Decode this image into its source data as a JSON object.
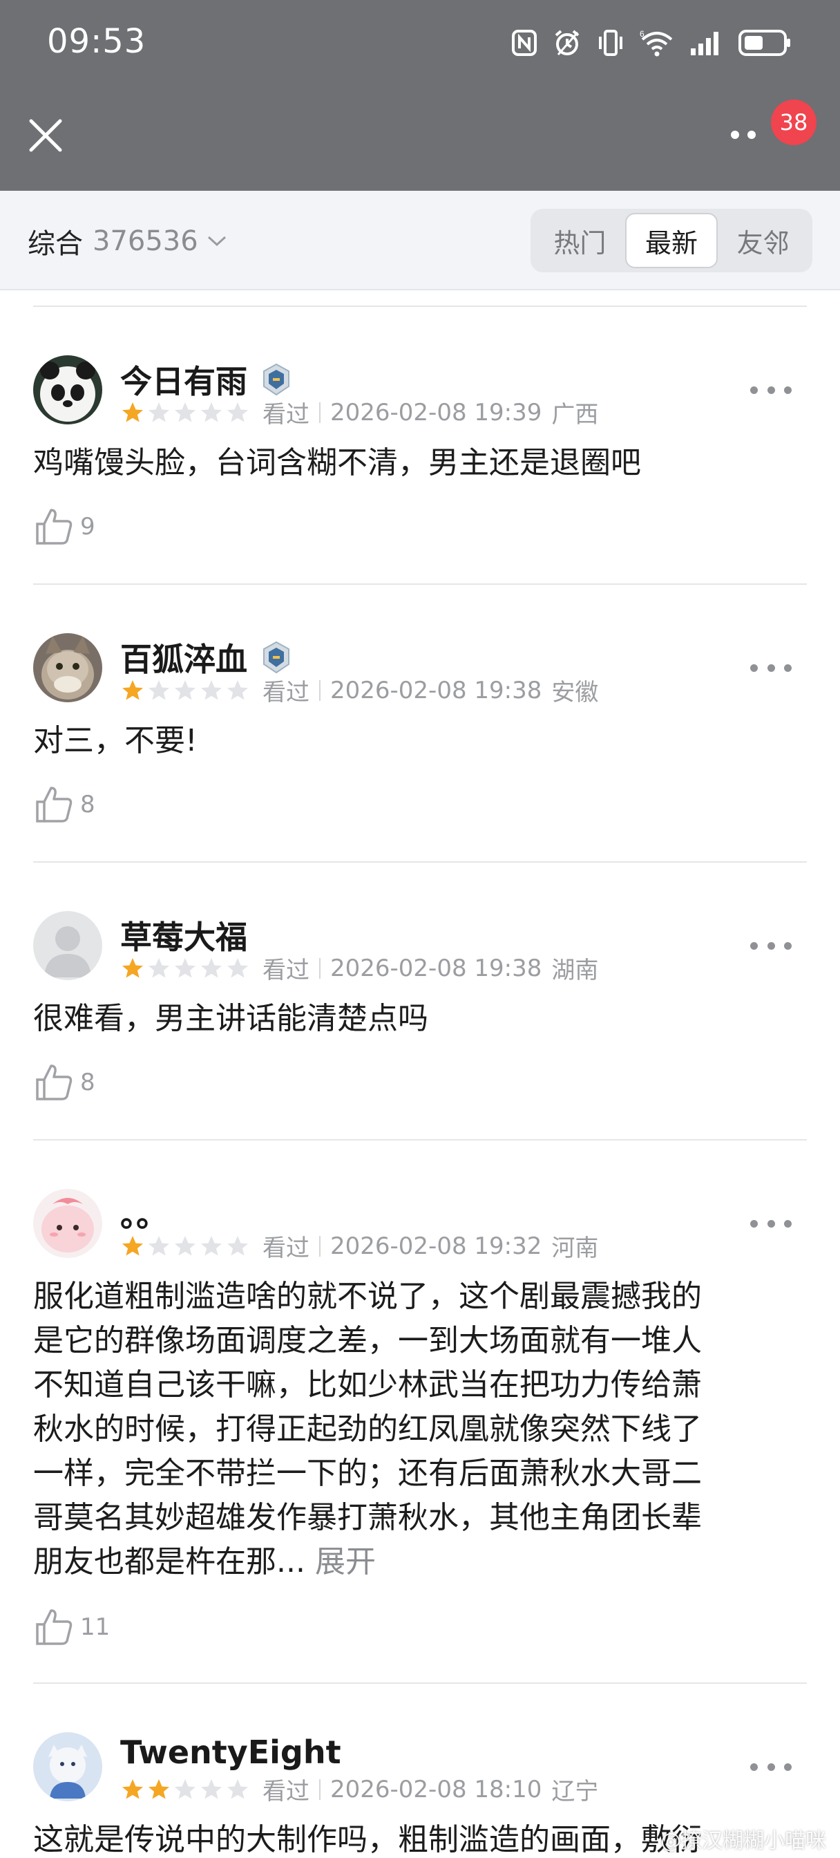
{
  "status_bar": {
    "time": "09:53",
    "icons": [
      "nfc-icon",
      "alarm-icon",
      "vibrate-icon",
      "wifi-6-icon",
      "signal-icon",
      "battery-icon"
    ]
  },
  "nav": {
    "close_icon": "close-icon",
    "more_icon": "more-dots-icon",
    "badge_count": "38"
  },
  "filter": {
    "label": "综合",
    "count": "376536",
    "tabs": [
      {
        "label": "热门",
        "active": false
      },
      {
        "label": "最新",
        "active": true
      },
      {
        "label": "友邻",
        "active": false
      }
    ]
  },
  "reviews": [
    {
      "username": "今日有雨",
      "has_medal": true,
      "rating": 1,
      "status": "看过",
      "datetime": "2026-02-08 19:39",
      "region": "广西",
      "content": "鸡嘴馒头脸，台词含糊不清，男主还是退圈吧",
      "likes": "9",
      "avatar": "panda"
    },
    {
      "username": "百狐淬血",
      "has_medal": true,
      "rating": 1,
      "status": "看过",
      "datetime": "2026-02-08 19:38",
      "region": "安徽",
      "content": "对三，不要!",
      "likes": "8",
      "avatar": "cat"
    },
    {
      "username": "草莓大福",
      "has_medal": false,
      "rating": 1,
      "status": "看过",
      "datetime": "2026-02-08 19:38",
      "region": "湖南",
      "content": "很难看，男主讲话能清楚点吗",
      "likes": "8",
      "avatar": "default"
    },
    {
      "username": "。。",
      "has_medal": false,
      "rating": 1,
      "status": "看过",
      "datetime": "2026-02-08 19:32",
      "region": "河南",
      "content_lines": [
        "服化道粗制滥造啥的就不说了，这个剧最震撼我的",
        "是它的群像场面调度之差，一到大场面就有一堆人",
        "不知道自己该干嘛，比如少林武当在把功力传给萧",
        "秋水的时候，打得正起劲的红凤凰就像突然下线了",
        "一样，完全不带拦一下的；还有后面萧秋水大哥二",
        "哥莫名其妙超雄发作暴打萧秋水，其他主角团长辈",
        "朋友也都是杵在那..."
      ],
      "expand_label": "展开",
      "likes": "11",
      "avatar": "pink"
    },
    {
      "username": "TwentyEight",
      "has_medal": false,
      "rating": 2,
      "status": "看过",
      "datetime": "2026-02-08 18:10",
      "region": "辽宁",
      "content": "这就是传说中的大制作吗，粗制滥造的画面，敷衍",
      "likes": "",
      "avatar": "blue"
    }
  ],
  "watermark": "@撩汉糊糊小喵咪",
  "colors": {
    "header_bg": "#6e7074",
    "badge": "#f0444e",
    "star_active": "#f5a623",
    "star_inactive": "#e2e3e6"
  }
}
